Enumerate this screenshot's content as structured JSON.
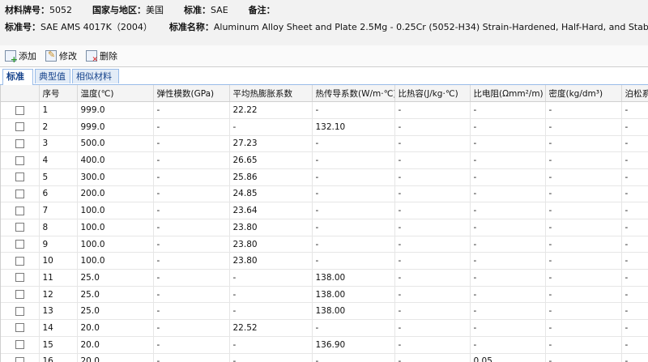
{
  "info": {
    "material_label": "材料牌号：",
    "material_value": "5052",
    "country_label": "国家与地区：",
    "country_value": "美国",
    "standard_label": "标准：",
    "standard_value": "SAE",
    "remark_label": "备注：",
    "std_no_label": "标准号：",
    "std_no_value": "SAE AMS 4017K（2004）",
    "std_name_label": "标准名称：",
    "std_name_value": "Aluminum Alloy Sheet and Plate 2.5Mg - 0.25Cr (5052-H34) Strain-Hardened, Half-Hard, and Stabilized"
  },
  "toolbar": {
    "add": "添加",
    "edit": "修改",
    "delete": "删除"
  },
  "tabs": [
    "标准",
    "典型值",
    "相似材料"
  ],
  "columns": [
    "",
    "序号",
    "温度(℃)",
    "弹性模数(GPa)",
    "平均热膨胀系数",
    "热传导系数(W/m·℃)",
    "比热容(J/kg·℃)",
    "比电阻(Ωmm²/m)",
    "密度(kg/dm³)",
    "泊松系数"
  ],
  "rows": [
    [
      "1",
      "999.0",
      "-",
      "22.22",
      "-",
      "-",
      "-",
      "-",
      "-"
    ],
    [
      "2",
      "999.0",
      "-",
      "-",
      "132.10",
      "-",
      "-",
      "-",
      "-"
    ],
    [
      "3",
      "500.0",
      "-",
      "27.23",
      "-",
      "-",
      "-",
      "-",
      "-"
    ],
    [
      "4",
      "400.0",
      "-",
      "26.65",
      "-",
      "-",
      "-",
      "-",
      "-"
    ],
    [
      "5",
      "300.0",
      "-",
      "25.86",
      "-",
      "-",
      "-",
      "-",
      "-"
    ],
    [
      "6",
      "200.0",
      "-",
      "24.85",
      "-",
      "-",
      "-",
      "-",
      "-"
    ],
    [
      "7",
      "100.0",
      "-",
      "23.64",
      "-",
      "-",
      "-",
      "-",
      "-"
    ],
    [
      "8",
      "100.0",
      "-",
      "23.80",
      "-",
      "-",
      "-",
      "-",
      "-"
    ],
    [
      "9",
      "100.0",
      "-",
      "23.80",
      "-",
      "-",
      "-",
      "-",
      "-"
    ],
    [
      "10",
      "100.0",
      "-",
      "23.80",
      "-",
      "-",
      "-",
      "-",
      "-"
    ],
    [
      "11",
      "25.0",
      "-",
      "-",
      "138.00",
      "-",
      "-",
      "-",
      "-"
    ],
    [
      "12",
      "25.0",
      "-",
      "-",
      "138.00",
      "-",
      "-",
      "-",
      "-"
    ],
    [
      "13",
      "25.0",
      "-",
      "-",
      "138.00",
      "-",
      "-",
      "-",
      "-"
    ],
    [
      "14",
      "20.0",
      "-",
      "22.52",
      "-",
      "-",
      "-",
      "-",
      "-"
    ],
    [
      "15",
      "20.0",
      "-",
      "-",
      "136.90",
      "-",
      "-",
      "-",
      "-"
    ],
    [
      "16",
      "20.0",
      "-",
      "-",
      "-",
      "-",
      "0.05",
      "-",
      "-"
    ]
  ]
}
